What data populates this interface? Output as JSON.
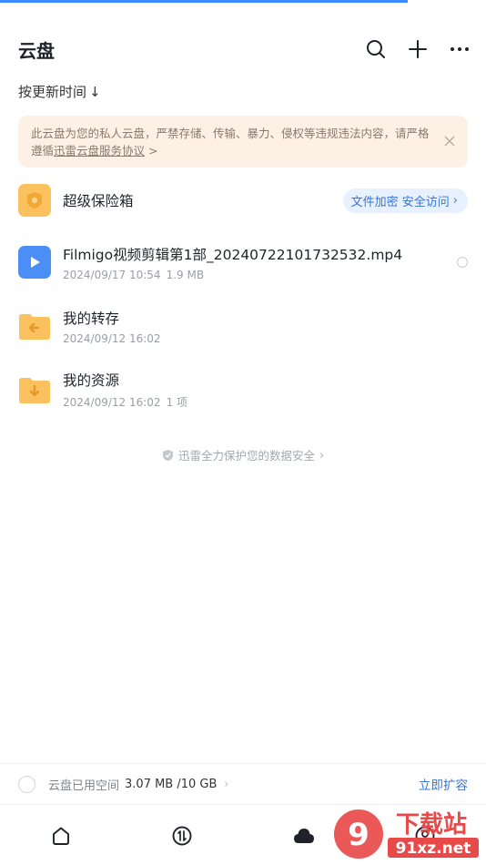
{
  "header": {
    "title": "云盘",
    "icons": [
      "search-icon",
      "plus-icon",
      "more-icon"
    ]
  },
  "sort": {
    "label": "按更新时间",
    "arrow": "↓"
  },
  "notice": {
    "text": "此云盘为您的私人云盘，严禁存储、传输、暴力、侵权等违规违法内容，请严格遵循",
    "link": "迅雷云盘服务协议",
    "link_suffix": " >"
  },
  "vault": {
    "name": "超级保险箱",
    "action": "文件加密 安全访问",
    "action_chevron": "›"
  },
  "files": [
    {
      "name": "Filmigo视频剪辑第1部_20240722101732532.mp4",
      "date": "2024/09/17 10:54",
      "extra": "1.9 MB",
      "icon": "video-file-icon"
    },
    {
      "name": "我的转存",
      "date": "2024/09/12 16:02",
      "extra": "",
      "icon": "transfer-folder-icon"
    },
    {
      "name": "我的资源",
      "date": "2024/09/12 16:02",
      "extra": "1 项",
      "icon": "download-folder-icon"
    }
  ],
  "safety": {
    "text": "迅雷全力保护您的数据安全",
    "chevron": "›"
  },
  "storage": {
    "label": "云盘已用空间",
    "value": "3.07 MB /10 GB",
    "chevron": "›",
    "expand": "立即扩容"
  },
  "tabs": [
    {
      "name": "home",
      "icon": "home-icon"
    },
    {
      "name": "transfer",
      "icon": "transfer-icon"
    },
    {
      "name": "cloud",
      "icon": "cloud-icon"
    },
    {
      "name": "profile",
      "icon": "profile-icon"
    }
  ],
  "watermark": {
    "text_top": "下载站",
    "text_bottom": "91xz.net",
    "logo": "9"
  },
  "colors": {
    "accent": "#3775d8",
    "progress": "#3d8bff",
    "notice_bg": "#fdf1e6",
    "folder": "#fbc15f",
    "video": "#4b8ef5"
  }
}
